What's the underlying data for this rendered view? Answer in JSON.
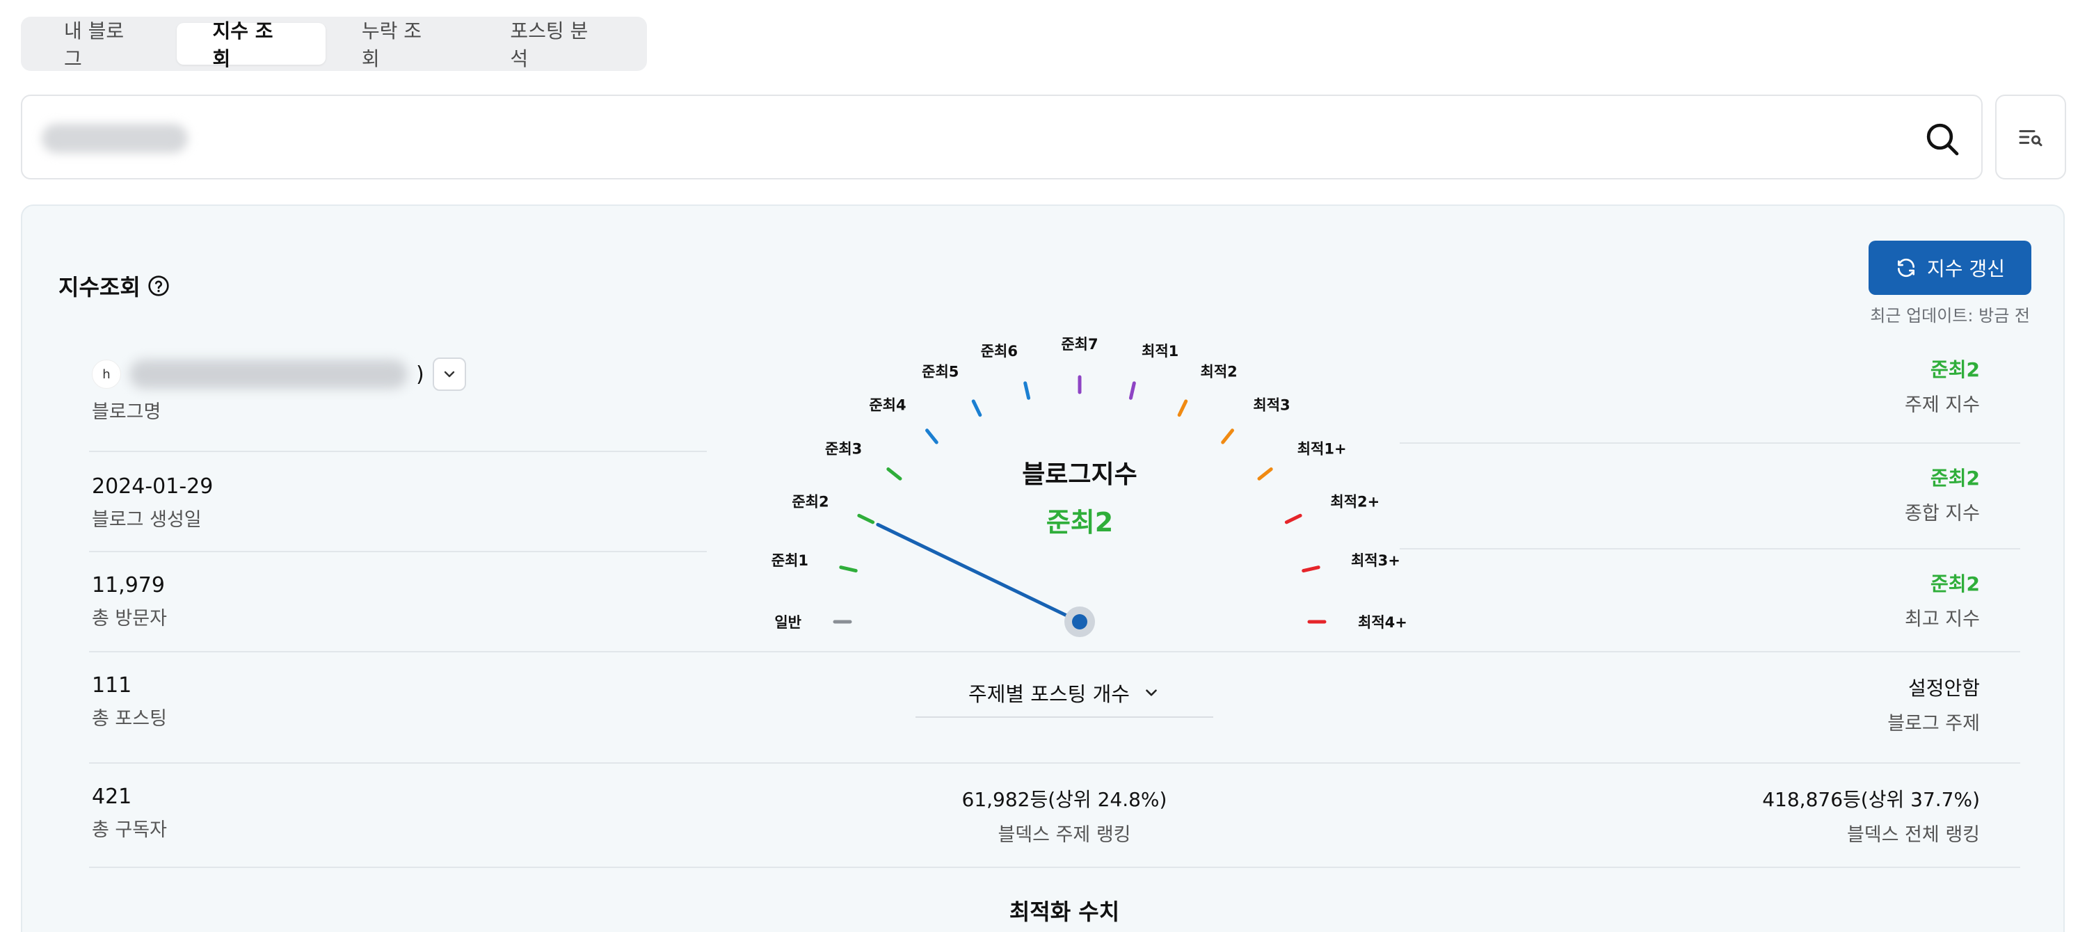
{
  "tabs": [
    {
      "label": "내 블로그",
      "active": false
    },
    {
      "label": "지수 조회",
      "active": true
    },
    {
      "label": "누락 조회",
      "active": false
    },
    {
      "label": "포스팅 분석",
      "active": false
    }
  ],
  "search": {
    "value": "",
    "placeholder": ""
  },
  "panel": {
    "title": "지수조회",
    "refresh_label": "지수 갱신",
    "update_label": "최근 업데이트:",
    "update_value": "방금 전"
  },
  "left": {
    "blog_avatar_text": "h",
    "blog_name_suffix": ")",
    "blog_name_label": "블로그명",
    "created_value": "2024-01-29",
    "created_label": "블로그 생성일",
    "visitors_value": "11,979",
    "visitors_label": "총 방문자",
    "posts_value": "111",
    "posts_label": "총 포스팅",
    "subscribers_value": "421",
    "subscribers_label": "총 구독자"
  },
  "gauge": {
    "title": "블로그지수",
    "value": "준최2",
    "current_index": 2,
    "ticks": [
      {
        "label": "일반",
        "color": "#8a8f95"
      },
      {
        "label": "준최1",
        "color": "#2fae3a"
      },
      {
        "label": "준최2",
        "color": "#2fae3a"
      },
      {
        "label": "준최3",
        "color": "#2fae3a"
      },
      {
        "label": "준최4",
        "color": "#1b7fd1"
      },
      {
        "label": "준최5",
        "color": "#1b7fd1"
      },
      {
        "label": "준최6",
        "color": "#1b7fd1"
      },
      {
        "label": "준최7",
        "color": "#8e44c4"
      },
      {
        "label": "최적1",
        "color": "#8e44c4"
      },
      {
        "label": "최적2",
        "color": "#f08a12"
      },
      {
        "label": "최적3",
        "color": "#f08a12"
      },
      {
        "label": "최적1+",
        "color": "#f08a12"
      },
      {
        "label": "최적2+",
        "color": "#e5252a"
      },
      {
        "label": "최적3+",
        "color": "#e5252a"
      },
      {
        "label": "최적4+",
        "color": "#e5252a"
      }
    ],
    "needle_color": "#1762b3",
    "value_color": "#2fae3a"
  },
  "center": {
    "dropdown_label": "주제별 포스팅 개수",
    "topic_rank_value": "61,982등(상위 24.8%)",
    "topic_rank_label": "블덱스 주제 랭킹",
    "section_title": "최적화 수치"
  },
  "right": {
    "topic_index_value": "준최2",
    "topic_index_label": "주제 지수",
    "total_index_value": "준최2",
    "total_index_label": "종합 지수",
    "max_index_value": "준최2",
    "max_index_label": "최고 지수",
    "blog_topic_value": "설정안함",
    "blog_topic_label": "블로그 주제",
    "total_rank_value": "418,876등(상위 37.7%)",
    "total_rank_label": "블덱스 전체 랭킹"
  },
  "colors": {
    "accent": "#1762b3",
    "green": "#2fae3a"
  }
}
